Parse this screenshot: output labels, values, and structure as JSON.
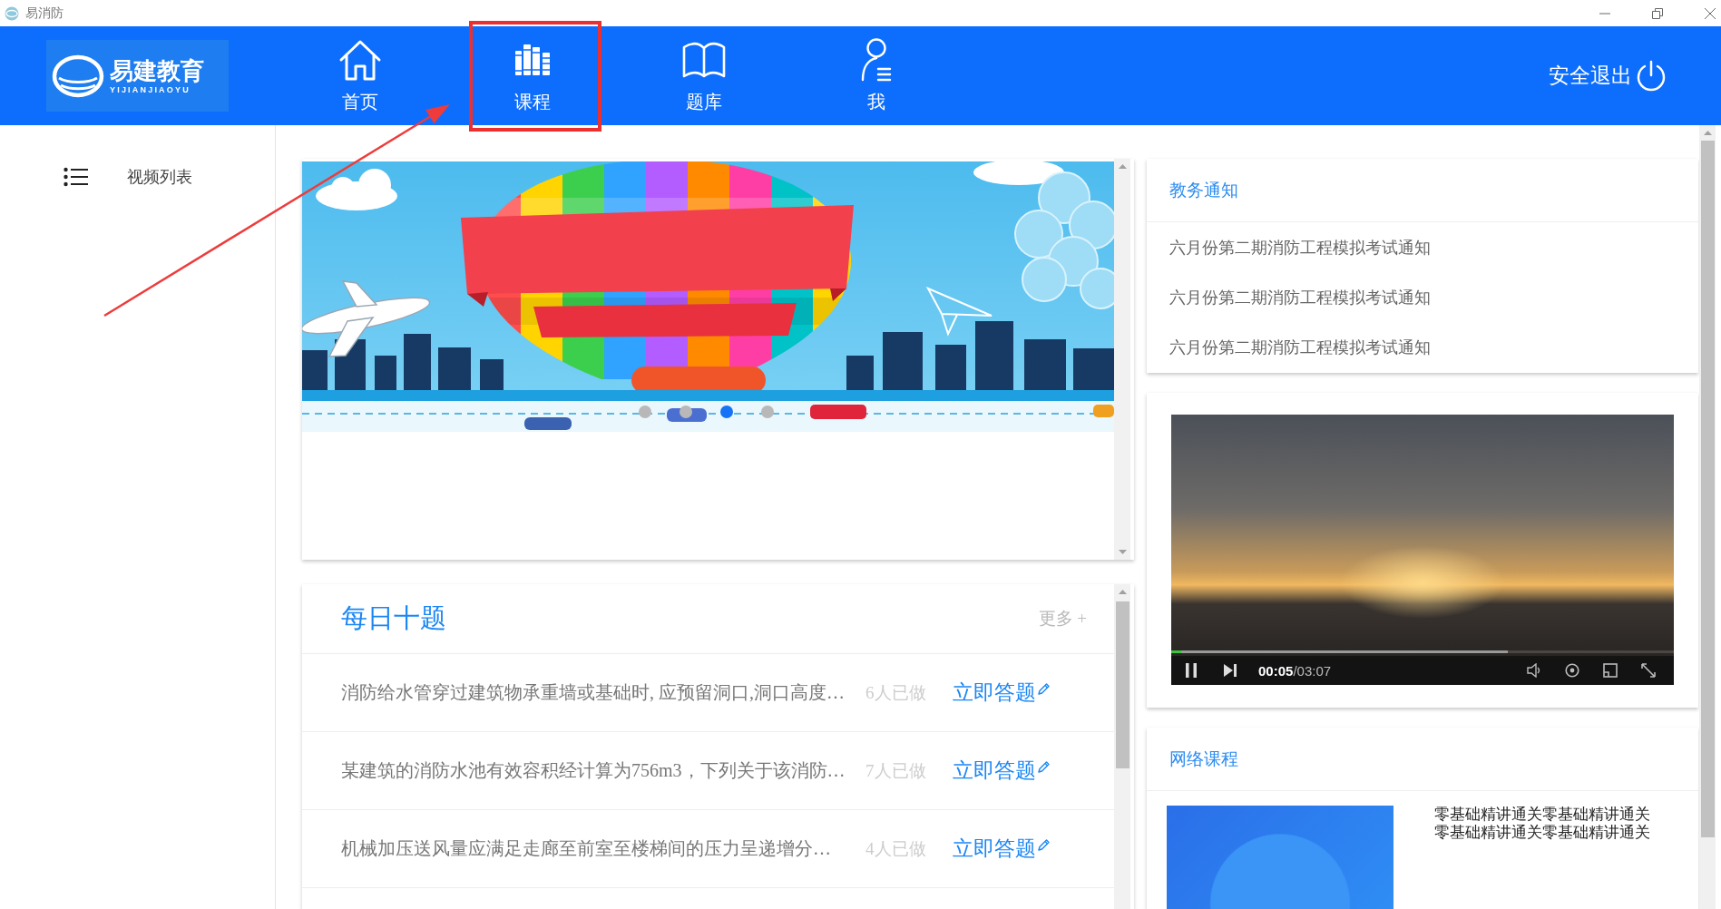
{
  "window": {
    "title": "易消防"
  },
  "navbar": {
    "logo": {
      "name": "易建教育",
      "subtitle": "YIJIANJIAOYU"
    },
    "items": [
      {
        "kind": "home",
        "label": "首页",
        "annotated": false
      },
      {
        "kind": "courses",
        "label": "课程",
        "annotated": true
      },
      {
        "kind": "library",
        "label": "题库",
        "annotated": false
      },
      {
        "kind": "profile",
        "label": "我",
        "annotated": false
      }
    ],
    "logout": "安全退出"
  },
  "sidebar": {
    "items": [
      {
        "label": "视频列表"
      }
    ]
  },
  "banner": {
    "dots": [
      {
        "selected": false
      },
      {
        "selected": false
      },
      {
        "selected": true
      },
      {
        "selected": false
      }
    ]
  },
  "daily_questions": {
    "title": "每日十题",
    "more": "更多 +",
    "rows": [
      {
        "question": "消防给水管穿过建筑物承重墙或基础时, 应预留洞口,洞口高度…",
        "count": "6人已做",
        "action": "立即答题"
      },
      {
        "question": "某建筑的消防水池有效容积经计算为756m3，下列关于该消防…",
        "count": "7人已做",
        "action": "立即答题"
      },
      {
        "question": "机械加压送风量应满足走廊至前室至楼梯间的压力呈递增分…",
        "count": "4人已做",
        "action": "立即答题"
      }
    ]
  },
  "notices": {
    "title": "教务通知",
    "items": [
      "六月份第二期消防工程模拟考试通知",
      "六月份第二期消防工程模拟考试通知",
      "六月份第二期消防工程模拟考试通知"
    ]
  },
  "video": {
    "playing": true,
    "time": "**00:05**/03:07",
    "buffered": {
      "level": 0.67
    },
    "progress": {
      "level": 0.02
    }
  },
  "courses": {
    "title": "网络课程",
    "items": [
      {
        "description": "零基础精讲通关零基础精讲通关零基础精讲通关零基础精讲通关"
      }
    ]
  }
}
